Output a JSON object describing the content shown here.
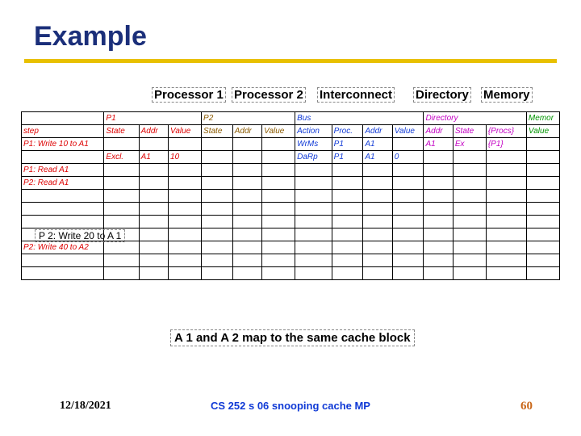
{
  "title": "Example",
  "sections": {
    "p1": "Processor 1",
    "p2": "Processor 2",
    "bus": "Interconnect",
    "dir": "Directory",
    "mem": "Memory"
  },
  "top_groups": {
    "p1": "P1",
    "p2": "P2",
    "bus": "Bus",
    "dir": "Directory",
    "mem": "Memor"
  },
  "headers": {
    "step": "step",
    "state1": "State",
    "addr1": "Addr",
    "value1": "Value",
    "state2": "State",
    "addr2": "Addr",
    "value2": "Value",
    "action": "Action",
    "proc": "Proc.",
    "baddr": "Addr",
    "bvalue": "Value",
    "daddr": "Addr",
    "dstate": "State",
    "procs": "{Procs}",
    "mvalue": "Value"
  },
  "rows": [
    {
      "step": "P1: Write 10 to A1",
      "action": "WrMs",
      "proc": "P1",
      "baddr": "A1",
      "daddr": "A1",
      "dstate": "Ex",
      "procs": "{P1}"
    },
    {
      "step": "",
      "state1": "Excl.",
      "addr1": "A1",
      "value1": "10",
      "action": "DaRp",
      "proc": "P1",
      "baddr": "A1",
      "bvalue": "0"
    },
    {
      "step": "P1: Read A1"
    },
    {
      "step": "P2: Read A1"
    },
    {
      "step": ""
    },
    {
      "step": ""
    },
    {
      "step": ""
    },
    {
      "step": ""
    },
    {
      "step": "P2: Write 40 to A2"
    },
    {
      "step": ""
    },
    {
      "step": ""
    }
  ],
  "step_callout": "P 2: Write 20 to A 1",
  "caption": "A 1 and A 2 map to the same cache block",
  "footer": {
    "date": "12/18/2021",
    "center": "CS 252 s 06 snooping cache MP",
    "page": "60"
  }
}
